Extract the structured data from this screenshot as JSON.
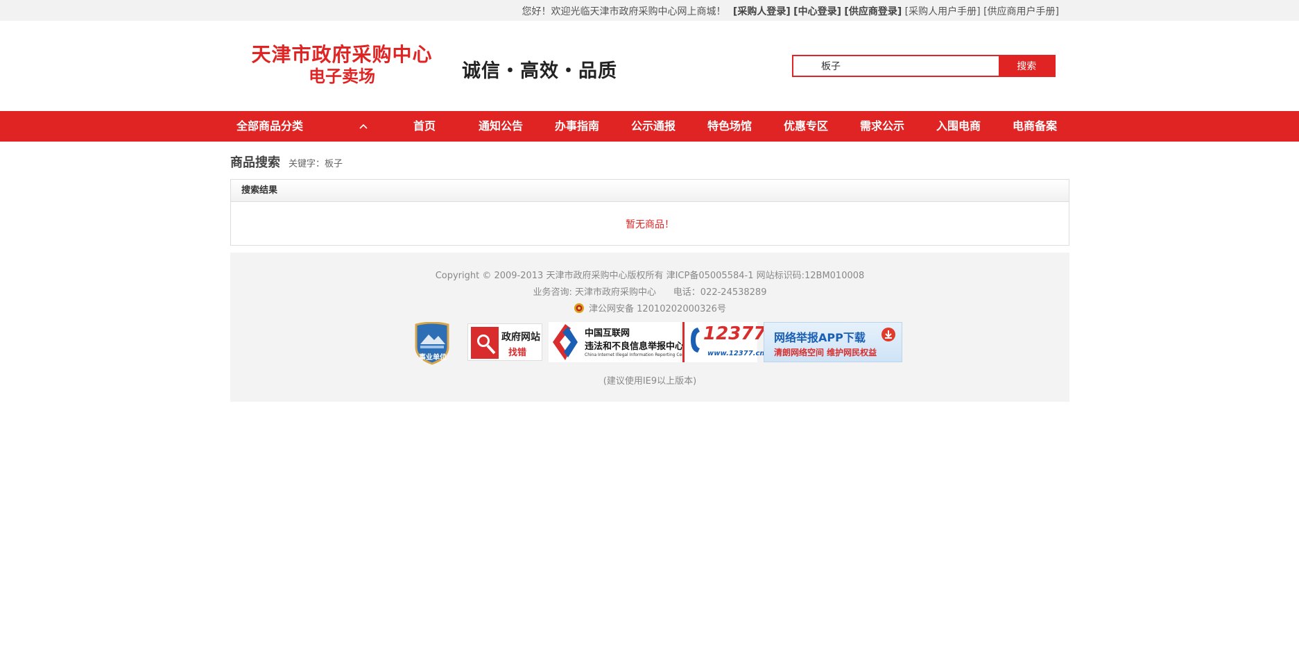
{
  "topbar": {
    "greeting": "您好！欢迎光临天津市政府采购中心网上商城！",
    "links": [
      {
        "label": "[采购人登录]",
        "strong": true
      },
      {
        "label": "[中心登录]",
        "strong": true
      },
      {
        "label": "[供应商登录]",
        "strong": true
      },
      {
        "label": "[采购人用户手册]",
        "strong": false
      },
      {
        "label": "[供应商用户手册]",
        "strong": false
      }
    ]
  },
  "header": {
    "logo_line1": "天津市政府采购中心",
    "logo_line2": "电子卖场",
    "slogan": "诚信・高效・品质"
  },
  "search": {
    "value": "板子",
    "button_label": "搜索"
  },
  "nav": {
    "category_label": "全部商品分类",
    "items": [
      "首页",
      "通知公告",
      "办事指南",
      "公示通报",
      "特色场馆",
      "优惠专区",
      "需求公示",
      "入围电商",
      "电商备案"
    ]
  },
  "breadcrumb": {
    "title": "商品搜索",
    "keyword_label": "关键字：板子"
  },
  "results": {
    "header": "搜索结果",
    "empty_message": "暂无商品！"
  },
  "footer": {
    "copyright": "Copyright © 2009-2013 天津市政府采购中心版权所有 津ICP备05005584-1 网站标识码:12BM010008",
    "contact": "业务咨询: 天津市政府采购中心      电话：022-24538289",
    "police": "津公网安备 12010202000326号",
    "browser_note": "(建议使用IE9以上版本)",
    "badges": {
      "shield": "事业单位",
      "findbug_line1": "政府网站",
      "findbug_line2": "找错",
      "illegal_line1": "中国互联网",
      "illegal_line2": "违法和不良信息举报中心",
      "illegal_line3": "China Internet Illegal Information Reporting Center",
      "n12377": "12377",
      "n12377_url": "www.12377.cn",
      "app_line1": "网络举报APP下载",
      "app_line2": "清朗网络空间  维护网民权益"
    }
  },
  "colors": {
    "brand_red": "#e02424",
    "footer_bg": "#f3f3f3"
  }
}
